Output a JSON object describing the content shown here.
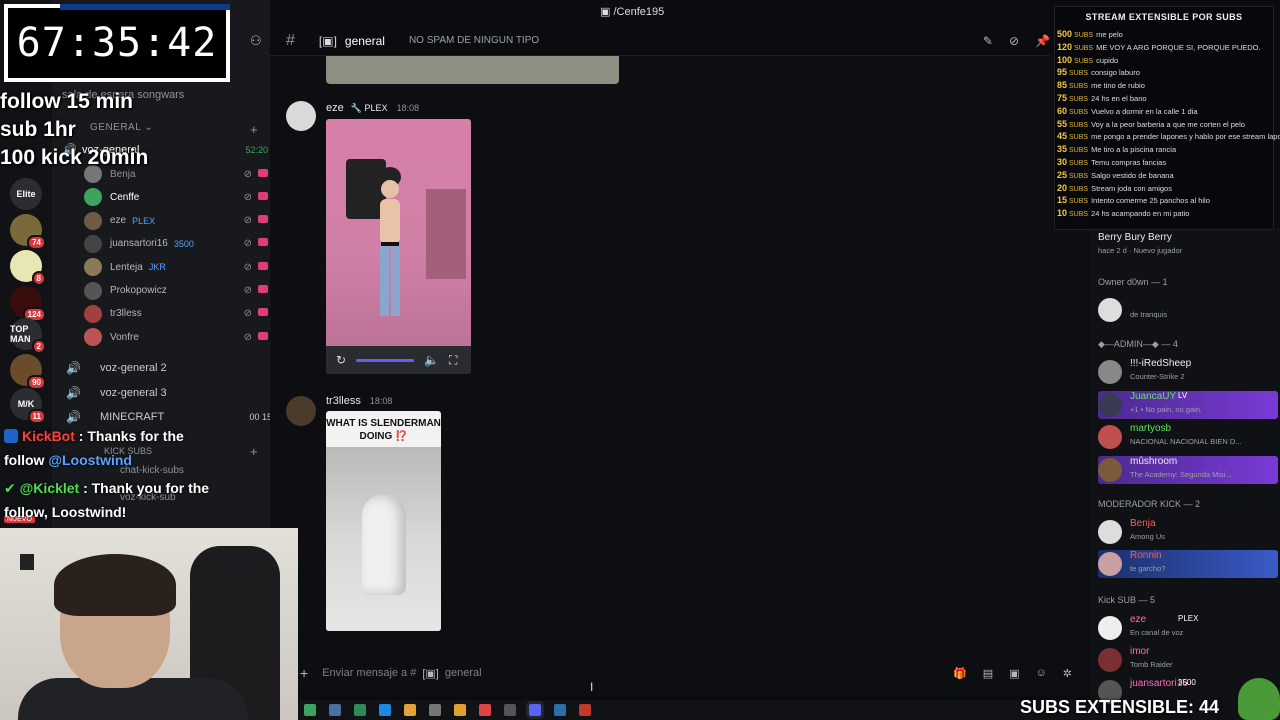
{
  "window": {
    "title": "/Cenfe195"
  },
  "overlay": {
    "timer": "67:35:42",
    "rules": [
      "follow 15 min",
      "sub 1hr",
      "100 kick 20min"
    ],
    "chat": [
      {
        "user": "KickBot",
        "text": ": Thanks for the",
        "line2": "follow ",
        "mention": "@Loostwind"
      },
      {
        "user": "@Kicklet",
        "text": ": Thank you for the",
        "line2": "follow, Loostwind!"
      }
    ],
    "subs_extensible": "SUBS EXTENSIBLE: 44"
  },
  "rail": {
    "servers": [
      {
        "label": "Elite",
        "badge": ""
      },
      {
        "label": "",
        "badge": "74"
      },
      {
        "label": "",
        "badge": "8"
      },
      {
        "label": "",
        "badge": "124"
      },
      {
        "label": "TOP MAN",
        "badge": "2"
      },
      {
        "label": "",
        "badge": "90"
      },
      {
        "label": "M/K",
        "badge": "11"
      }
    ]
  },
  "sidebar": {
    "stage": "sala de espera songwars",
    "category": "GENERAL",
    "voice_main": {
      "name": "voz-general",
      "time": "52:20"
    },
    "users": [
      {
        "name": "Benja",
        "tag": "",
        "color": "#8e9297"
      },
      {
        "name": "Cenffe",
        "tag": "",
        "color": "#ffffff"
      },
      {
        "name": "eze",
        "tag": "PLEX",
        "color": "#b5b7bb"
      },
      {
        "name": "juansartori16",
        "tag": "3500",
        "color": "#b5b7bb"
      },
      {
        "name": "Lenteja",
        "tag": "JKR",
        "color": "#b5b7bb"
      },
      {
        "name": "Prokopowicz",
        "tag": "",
        "color": "#b5b7bb"
      },
      {
        "name": "tr3lless",
        "tag": "",
        "color": "#b5b7bb"
      },
      {
        "name": "Vonfre",
        "tag": "",
        "color": "#b5b7bb"
      }
    ],
    "voice_others": [
      {
        "name": "voz-general 2",
        "count": ""
      },
      {
        "name": "voz-general 3",
        "count": ""
      },
      {
        "name": "MINECRAFT",
        "count": "00 15"
      }
    ],
    "kick_category": "KICK SUBS",
    "kick_channels": [
      "chat-kick-subs",
      "voz-kick-sub"
    ],
    "nuevo": "NUEVO"
  },
  "header": {
    "channel": "general",
    "topic": "NO SPAM DE NINGUN TIPO"
  },
  "messages": [
    {
      "author": "eze",
      "tag": "PLEX",
      "time": "18:08"
    },
    {
      "author": "tr3lless",
      "tag": "",
      "time": "18:08",
      "card_title": "WHAT IS SLENDERMAN DOING ⁉️"
    }
  ],
  "composer": {
    "placeholder_prefix": "Enviar mensaje a #",
    "placeholder_channel": "general"
  },
  "subs_panel": {
    "title": "STREAM EXTENSIBLE POR SUBS",
    "rows": [
      {
        "n": "500",
        "text": "me pelo"
      },
      {
        "n": "120",
        "text": "ME VOY A ARG PORQUE SI, PORQUE PUEDO."
      },
      {
        "n": "100",
        "text": "cupido"
      },
      {
        "n": "95",
        "text": "consigo laburo"
      },
      {
        "n": "85",
        "text": "me tino de rubio"
      },
      {
        "n": "75",
        "text": "24 hs en el bano"
      },
      {
        "n": "60",
        "text": "Vuelvo a dormir en la calle 1 dia"
      },
      {
        "n": "55",
        "text": "Voy a la peor barberia a que me corten el pelo"
      },
      {
        "n": "45",
        "text": "me pongo a prender lapones y hablo por ese stream lapones"
      },
      {
        "n": "35",
        "text": "Me tiro a la piscina rancia"
      },
      {
        "n": "30",
        "text": "Temu compras fancias"
      },
      {
        "n": "25",
        "text": "Salgo vestido de banana"
      },
      {
        "n": "20",
        "text": "Stream joda con amigos"
      },
      {
        "n": "15",
        "text": "Intento comerme 25 panchos al hilo"
      },
      {
        "n": "10",
        "text": "24 hs acampando en mi patio"
      }
    ],
    "unit": "SUBS"
  },
  "members": {
    "top_user": {
      "name": "Berry Bury Berry",
      "status": "hace 2 d  ·  Nuevo jugador"
    },
    "sections": [
      {
        "title": "Owner d0wn — 1",
        "members": [
          {
            "name": "",
            "status": "de tranquis",
            "color": "#eee"
          }
        ]
      },
      {
        "title": "◆—ADMIN—◆ — 4",
        "members": [
          {
            "name": "!!!-iRedSheep",
            "status": "Counter-Strike 2",
            "color": "#eee"
          },
          {
            "name": "JuancaUY",
            "status": "+1 • No pain, no gain.",
            "color": "#5fe35f",
            "tag": "LV"
          },
          {
            "name": "martyosb",
            "status": "NACIONAL NACIONAL BIEN D...",
            "color": "#5fe35f"
          },
          {
            "name": "mûshroom",
            "status": "The Academy: Segunda Misi...",
            "color": "#eee"
          }
        ]
      },
      {
        "title": "MODERADOR KICK — 2",
        "members": [
          {
            "name": "Benja",
            "status": "Among Us",
            "color": "#ff5a5a"
          },
          {
            "name": "Ronnin",
            "status": "te garcho?",
            "color": "#ff5a5a"
          }
        ]
      },
      {
        "title": "Kick SUB — 5",
        "members": [
          {
            "name": "eze",
            "status": "En canal de voz",
            "color": "#ff6bb5",
            "tag": "PLEX"
          },
          {
            "name": "imor",
            "status": "Tomb Raider",
            "color": "#ff6bb5"
          },
          {
            "name": "juansartori16",
            "status": "",
            "color": "#ff6bb5",
            "tag": "3500"
          }
        ]
      }
    ]
  },
  "colors": {
    "accent": "#5865f2",
    "bg": "#0d0e12",
    "sidebar": "#18191d"
  },
  "icons": [
    "hash-icon",
    "pin-icon",
    "members-icon",
    "gift-icon",
    "gif-icon",
    "sticker-icon",
    "emoji-icon",
    "apps-icon",
    "speaker-icon",
    "mic-muted-icon",
    "plus-icon"
  ]
}
